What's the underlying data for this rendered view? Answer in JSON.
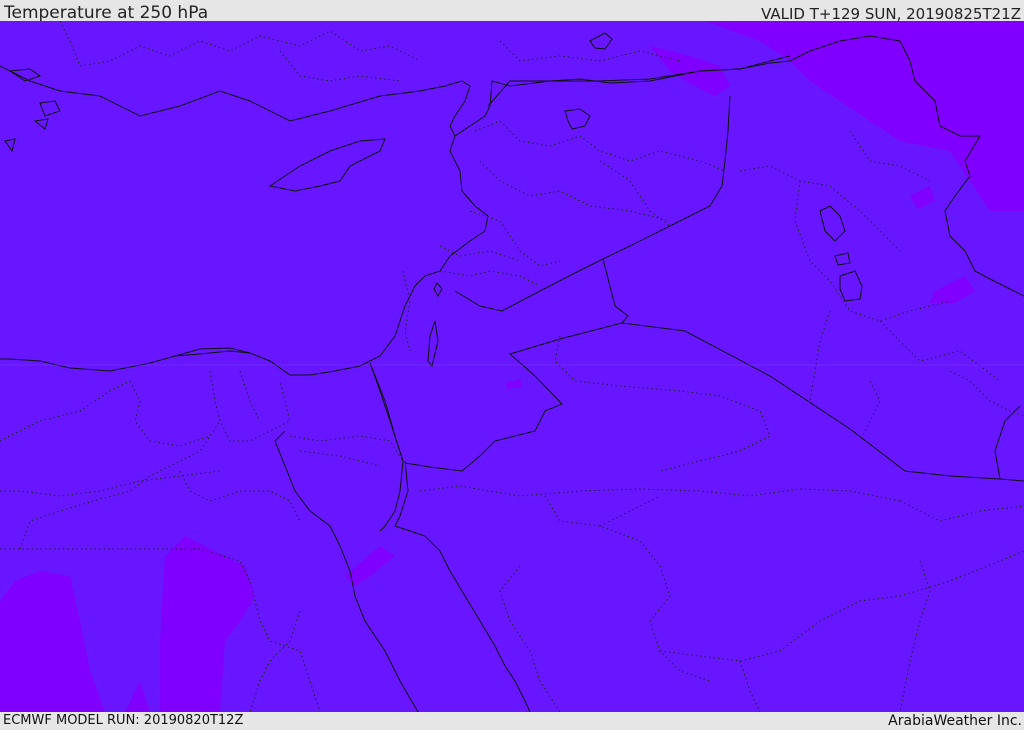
{
  "header": {
    "title": "Temperature at 250 hPa",
    "valid": "VALID T+129 SUN, 20190825T21Z"
  },
  "footer": {
    "model_run": "ECMWF MODEL RUN: 20190820T12Z",
    "credit": "ArabiaWeather Inc."
  },
  "map": {
    "fill_base": "#6816ff",
    "fill_cold": "#8000ff",
    "border_color": "#111111"
  }
}
